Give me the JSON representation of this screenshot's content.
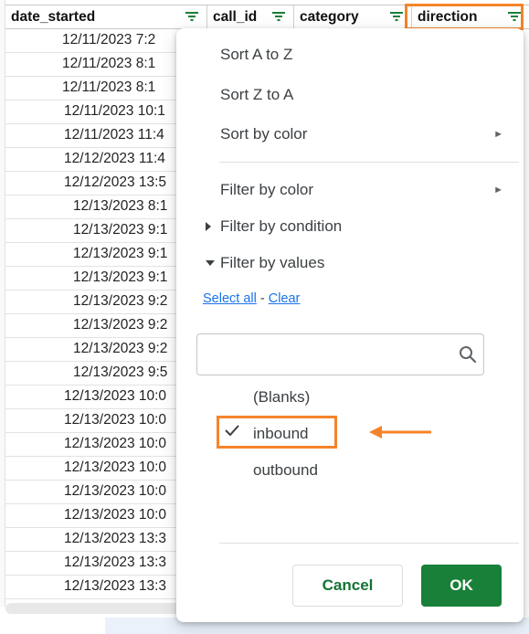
{
  "columns": [
    {
      "label": "date_started"
    },
    {
      "label": "call_id"
    },
    {
      "label": "category"
    },
    {
      "label": "direction"
    }
  ],
  "rows": [
    "12/11/2023 7:2",
    "12/11/2023 8:1",
    "12/11/2023 8:1",
    "12/11/2023 10:1",
    "12/11/2023 11:4",
    "12/12/2023 11:4",
    "12/12/2023 13:5",
    "12/13/2023 8:1",
    "12/13/2023 9:1",
    "12/13/2023 9:1",
    "12/13/2023 9:1",
    "12/13/2023 9:2",
    "12/13/2023 9:2",
    "12/13/2023 9:2",
    "12/13/2023 9:5",
    "12/13/2023 10:0",
    "12/13/2023 10:0",
    "12/13/2023 10:0",
    "12/13/2023 10:0",
    "12/13/2023 10:0",
    "12/13/2023 10:0",
    "12/13/2023 13:3",
    "12/13/2023 13:3",
    "12/13/2023 13:3"
  ],
  "menu": {
    "sort_az": "Sort A to Z",
    "sort_za": "Sort Z to A",
    "sort_color": "Sort by color",
    "filter_color": "Filter by color",
    "filter_condition": "Filter by condition",
    "filter_values": "Filter by values",
    "submenu_arrow": "►"
  },
  "values_panel": {
    "select_all": "Select all",
    "separator": " - ",
    "clear": "Clear",
    "search_placeholder": "",
    "items": [
      {
        "label": "(Blanks)",
        "checked": false
      },
      {
        "label": "inbound",
        "checked": true
      },
      {
        "label": "outbound",
        "checked": false
      }
    ]
  },
  "buttons": {
    "cancel": "Cancel",
    "ok": "OK"
  },
  "colors": {
    "highlight": "#f4842b",
    "ok_green": "#188038",
    "cancel_text": "#137333",
    "link_blue": "#1a73e8",
    "filter_icon": "#188038"
  },
  "icons": {
    "column_filter": "filter-icon",
    "search": "search-icon",
    "checkmark": "check-icon",
    "annotation_arrow": "left-arrow-icon"
  }
}
